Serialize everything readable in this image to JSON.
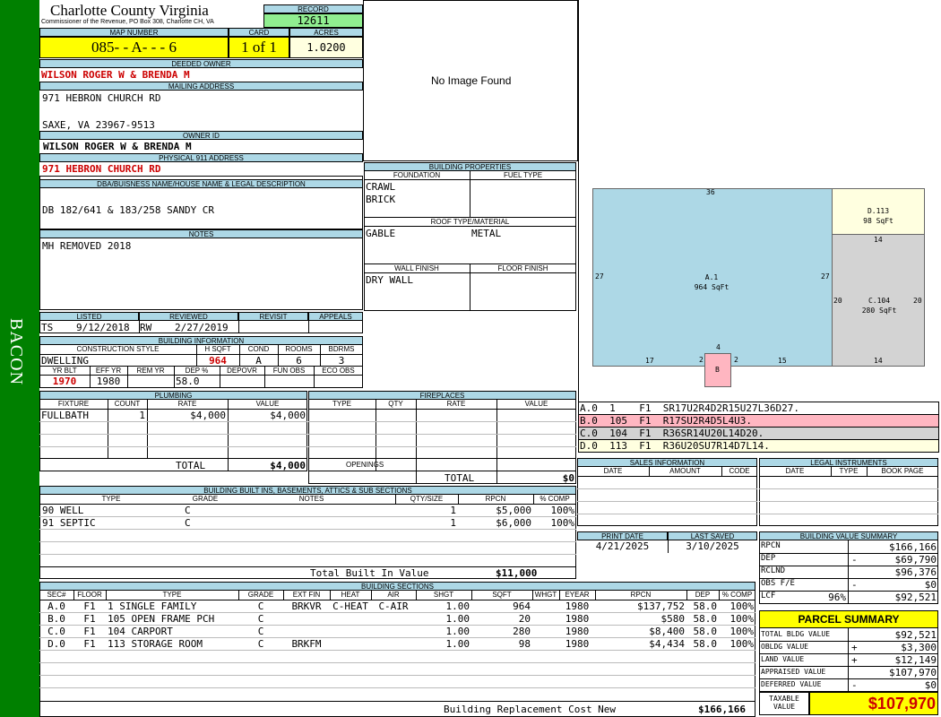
{
  "sidebar_label": "BACON",
  "header": {
    "county": "Charlotte County Virginia",
    "office": "Commissioner of the Revenue, PO Box 308, Charlotte CH, VA",
    "record_label": "RECORD",
    "record": "12611",
    "map_label": "MAP NUMBER",
    "map_number": "085- - A- - - 6",
    "card_label": "CARD",
    "card": "1 of 1",
    "acres_label": "ACRES",
    "acres": "1.0200"
  },
  "owner": {
    "deeded_label": "DEEDED OWNER",
    "deeded_owner": "WILSON ROGER W & BRENDA M",
    "mailing_label": "MAILING ADDRESS",
    "mailing_line1": "971 HEBRON CHURCH RD",
    "mailing_line2": "SAXE, VA 23967-9513",
    "owner_id_label": "OWNER ID",
    "owner_id": "WILSON ROGER W & BRENDA M",
    "physical_label": "PHYSICAL 911 ADDRESS",
    "physical_address": "971 HEBRON CHURCH RD",
    "dba_label": "DBA/BUISNESS NAME/HOUSE NAME & LEGAL DESCRIPTION",
    "legal_desc": "DB 182/641 & 183/258 SANDY CR",
    "notes_label": "NOTES",
    "notes": "MH REMOVED 2018"
  },
  "image": {
    "no_image": "No Image Found"
  },
  "building_properties": {
    "title": "BUILDING PROPERTIES",
    "foundation_label": "FOUNDATION",
    "fuel_label": "FUEL TYPE",
    "foundation1": "CRAWL",
    "foundation2": "BRICK",
    "roof_label": "ROOF TYPE/MATERIAL",
    "roof_type": "GABLE",
    "roof_material": "METAL",
    "wall_label": "WALL FINISH",
    "floor_label": "FLOOR FINISH",
    "wall_finish": "DRY WALL"
  },
  "sketch": {
    "a_top": "36",
    "a_left": "27",
    "a_right": "27",
    "a_name": "A.1",
    "a_area": "964 SqFt",
    "a_bottom1": "17",
    "a_bottom2": "15",
    "b_top": "4",
    "b_left": "2",
    "b_right": "2",
    "b_name": "B",
    "d_name": "D.113",
    "d_area": "98 SqFt",
    "d_bottom": "14",
    "c_left": "20",
    "c_right": "20",
    "c_name": "C.104",
    "c_area": "280 SqFt",
    "c_bottom": "14"
  },
  "sketch_legend": [
    {
      "text": "A.0  1    F1  SR17U2R4D2R15U27L36D27.",
      "color": "#ffffff"
    },
    {
      "text": "B.0  105  F1  R17SU2R4D5L4U3.",
      "color": "#ffb6c1"
    },
    {
      "text": "C.0  104  F1  R36SR14U20L14D20.",
      "color": "#d3d3d3"
    },
    {
      "text": "D.0  113  F1  R36U20SU7R14D7L14.",
      "color": "#ffffe0"
    }
  ],
  "listed": {
    "listed_label": "LISTED",
    "reviewed_label": "REVIEWED",
    "revisit_label": "REVISIT",
    "appeals_label": "APPEALS",
    "listed_by": "TS",
    "listed_date": "9/12/2018",
    "reviewed_by": "RW",
    "reviewed_date": "2/27/2019"
  },
  "building_info": {
    "title": "BUILDING INFORMATION",
    "style_label": "CONSTRUCTION STYLE",
    "hsqft_label": "H SQFT",
    "cond_label": "COND",
    "rooms_label": "ROOMS",
    "bdrms_label": "BDRMS",
    "style": "DWELLING",
    "hsqft": "964",
    "cond": "A",
    "rooms": "6",
    "bdrms": "3",
    "yrblt_label": "YR BLT",
    "effyr_label": "EFF YR",
    "remyr_label": "REM YR",
    "dep_label": "DEP %",
    "depovr_label": "DEPOVR",
    "funobs_label": "FUN OBS",
    "ecoobs_label": "ECO OBS",
    "yrblt": "1970",
    "effyr": "1980",
    "dep": "58.0"
  },
  "plumbing": {
    "title": "PLUMBING",
    "headers": [
      "FIXTURE",
      "COUNT",
      "RATE",
      "VALUE"
    ],
    "rows": [
      [
        "FULLBATH",
        "1",
        "$4,000",
        "$4,000"
      ]
    ],
    "total_label": "TOTAL",
    "total": "$4,000"
  },
  "fireplaces": {
    "title": "FIREPLACES",
    "headers": [
      "TYPE",
      "QTY",
      "RATE",
      "VALUE"
    ],
    "openings_label": "OPENINGS",
    "total_label": "TOTAL",
    "total": "$0"
  },
  "builtins": {
    "title": "BUILDING BUILT INS, BASEMENTS, ATTICS & SUB SECTIONS",
    "headers": [
      "TYPE",
      "GRADE",
      "NOTES",
      "QTY/SIZE",
      "RPCN",
      "% COMP"
    ],
    "rows": [
      [
        "90 WELL",
        "C",
        "",
        "1",
        "$5,000",
        "100%"
      ],
      [
        "91 SEPTIC",
        "C",
        "",
        "1",
        "$6,000",
        "100%"
      ]
    ],
    "total_label": "Total Built In Value",
    "total": "$11,000"
  },
  "sections": {
    "title": "BUILDING SECTIONS",
    "headers": [
      "SEC#",
      "FLOOR",
      "TYPE",
      "GRADE",
      "EXT FIN",
      "HEAT",
      "AIR",
      "SHGT",
      "SQFT",
      "WHGT",
      "EYEAR",
      "RPCN",
      "DEP",
      "% COMP"
    ],
    "rows": [
      [
        "A.0",
        "F1",
        "1 SINGLE FAMILY",
        "C",
        "BRKVR",
        "C-HEAT",
        "C-AIR",
        "1.00",
        "964",
        "",
        "1980",
        "$137,752",
        "58.0",
        "100%"
      ],
      [
        "B.0",
        "F1",
        "105 OPEN FRAME PCH",
        "C",
        "",
        "",
        "",
        "1.00",
        "20",
        "",
        "1980",
        "$580",
        "58.0",
        "100%"
      ],
      [
        "C.0",
        "F1",
        "104 CARPORT",
        "C",
        "",
        "",
        "",
        "1.00",
        "280",
        "",
        "1980",
        "$8,400",
        "58.0",
        "100%"
      ],
      [
        "D.0",
        "F1",
        "113 STORAGE ROOM",
        "C",
        "BRKFM",
        "",
        "",
        "1.00",
        "98",
        "",
        "1980",
        "$4,434",
        "58.0",
        "100%"
      ]
    ],
    "total_label": "Building Replacement Cost New",
    "total": "$166,166"
  },
  "sales": {
    "title": "SALES INFORMATION",
    "headers": [
      "DATE",
      "AMOUNT",
      "CODE"
    ]
  },
  "legal": {
    "title": "LEGAL INSTRUMENTS",
    "headers": [
      "DATE",
      "TYPE",
      "BOOK PAGE"
    ]
  },
  "dates": {
    "print_label": "PRINT DATE",
    "print_date": "4/21/2025",
    "saved_label": "LAST SAVED",
    "saved_date": "3/10/2025"
  },
  "value_summary": {
    "title": "BUILDING VALUE SUMMARY",
    "rows": [
      {
        "label": "RPCN",
        "sign": "",
        "value": "$166,166"
      },
      {
        "label": "DEP",
        "sign": "-",
        "value": "$69,790"
      },
      {
        "label": "RCLND",
        "sign": "",
        "value": "$96,376"
      },
      {
        "label": "OBS F/E",
        "sign": "-",
        "value": "$0"
      },
      {
        "label": "LCF",
        "sign": "96%",
        "value": "$92,521"
      }
    ]
  },
  "parcel_summary": {
    "title": "PARCEL SUMMARY",
    "rows": [
      {
        "label": "TOTAL BLDG VALUE",
        "sign": "",
        "value": "$92,521"
      },
      {
        "label": "OBLDG VALUE",
        "sign": "+",
        "value": "$3,300"
      },
      {
        "label": "LAND VALUE",
        "sign": "+",
        "value": "$12,149"
      },
      {
        "label": "APPRAISED VALUE",
        "sign": "",
        "value": "$107,970"
      },
      {
        "label": "DEFERRED VALUE",
        "sign": "-",
        "value": "$0"
      }
    ],
    "taxable_label": "TAXABLE VALUE",
    "taxable_value": "$107,970"
  },
  "colors": {
    "sidebar": "#008000",
    "header_bg": "#add8e6",
    "record_bg": "#90ee90",
    "map_bg": "#ffff00",
    "acres_bg": "#ffffe0",
    "red_text": "#cc0000"
  }
}
